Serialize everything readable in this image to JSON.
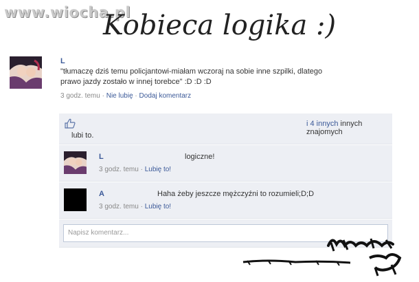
{
  "watermark": "www.wiocha.pl",
  "title": "Kobieca logika :)",
  "post": {
    "author": "L",
    "text_line1": "\"tłumaczę dziś temu policjantowi-miałam wczoraj na sobie inne szpilki, dlatego",
    "text_line2": "prawo jazdy zostało w innej torebce\" :D :D :D",
    "time": "3 godz. temu",
    "sep": "·",
    "dislike_label": "Nie lubię",
    "comment_label": "Dodaj komentarz"
  },
  "likes": {
    "count_link": "i 4 innych",
    "rest": "innych znajomych",
    "line2": "lubi to."
  },
  "comments": [
    {
      "author": "L",
      "text": "logiczne!",
      "time": "3 godz. temu",
      "sep": "·",
      "like_label": "Lubię to!"
    },
    {
      "author": "A",
      "text": "Haha żeby jeszcze mężczyźni to rozumieli;D;D",
      "time": "3 godz. temu",
      "sep": "·",
      "like_label": "Lubię to!"
    }
  ],
  "comment_input": {
    "placeholder": "Napisz komentarz..."
  },
  "colors": {
    "link": "#3b5998",
    "box_bg": "#edeff4",
    "meta_text": "#888888"
  },
  "icons": [
    "thumbs-up-icon"
  ]
}
